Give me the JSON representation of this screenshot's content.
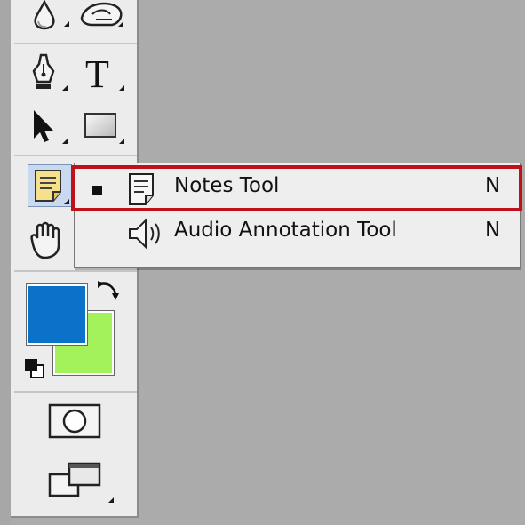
{
  "colors": {
    "foreground": "#0a73c9",
    "background": "#a3f15b",
    "highlight": "#c0111b"
  },
  "toolbar": {
    "tools": [
      {
        "name": "drop-icon"
      },
      {
        "name": "smudge-icon"
      },
      {
        "name": "pen-icon"
      },
      {
        "name": "type-icon",
        "glyph": "T"
      },
      {
        "name": "path-selection-icon"
      },
      {
        "name": "rectangle-icon"
      },
      {
        "name": "notes-icon"
      },
      {
        "name": "hand-icon"
      },
      {
        "name": "quick-mask-icon"
      },
      {
        "name": "screen-mode-icon"
      }
    ]
  },
  "flyout": {
    "items": [
      {
        "label": "Notes Tool",
        "shortcut": "N",
        "icon": "notes-icon",
        "selected": true
      },
      {
        "label": "Audio Annotation Tool",
        "shortcut": "N",
        "icon": "speaker-icon",
        "selected": false
      }
    ]
  }
}
